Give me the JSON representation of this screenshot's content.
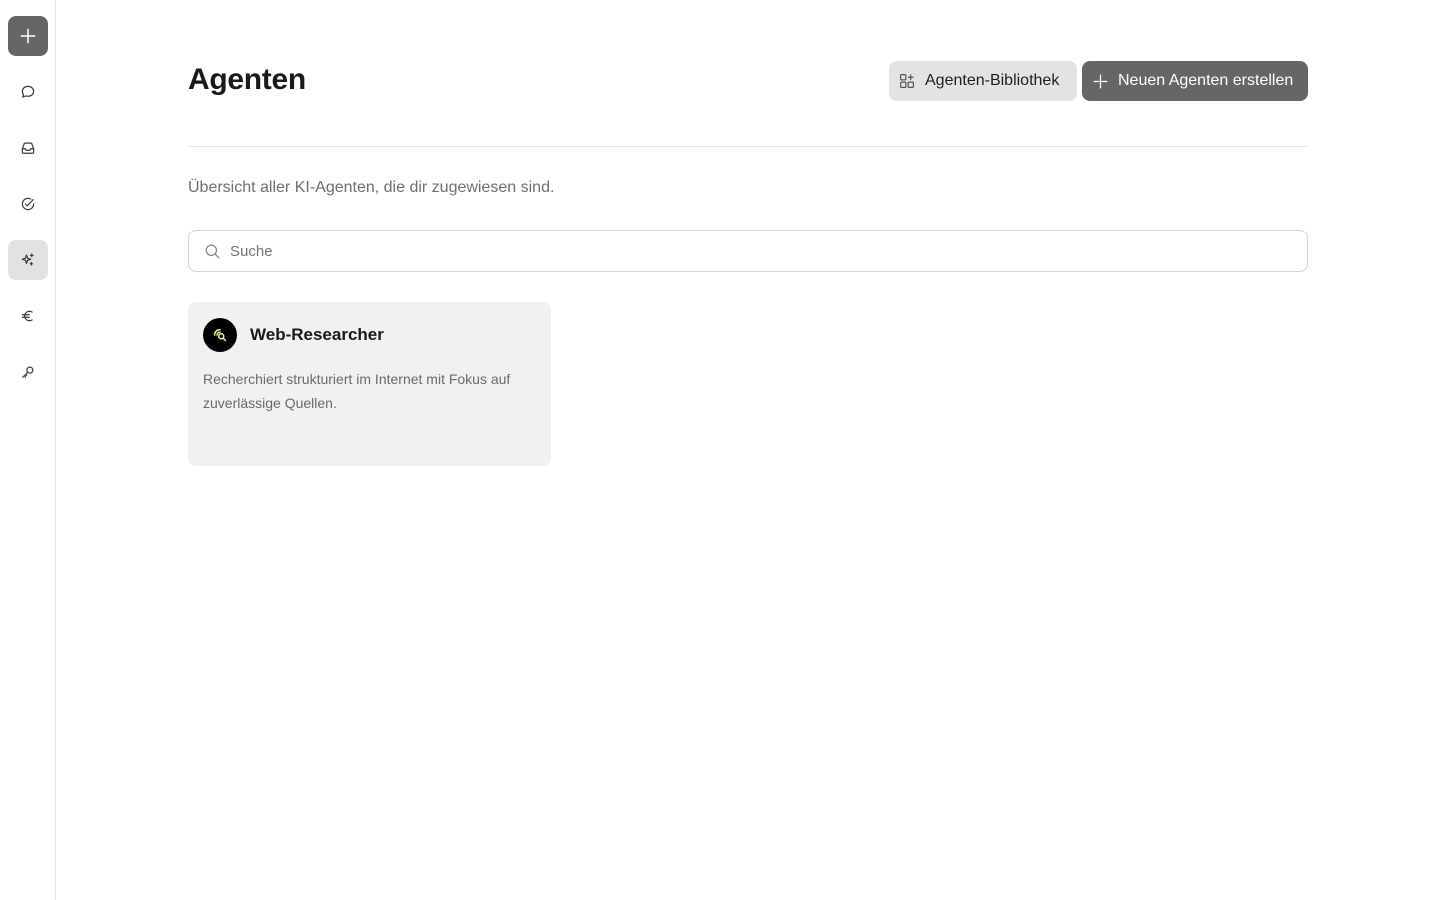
{
  "sidebar": {
    "items": [
      {
        "name": "new",
        "icon": "plus-icon"
      },
      {
        "name": "chat",
        "icon": "chat-bubble-icon"
      },
      {
        "name": "inbox",
        "icon": "inbox-icon"
      },
      {
        "name": "tasks",
        "icon": "check-circle-icon"
      },
      {
        "name": "agents",
        "icon": "sparkles-icon",
        "active": true
      },
      {
        "name": "billing",
        "icon": "euro-icon"
      },
      {
        "name": "keys",
        "icon": "key-icon"
      }
    ]
  },
  "header": {
    "title": "Agenten",
    "library_label": "Agenten-Bibliothek",
    "create_label": "Neuen Agenten erstellen"
  },
  "subtitle": "Übersicht aller KI-Agenten, die dir zugewiesen sind.",
  "search": {
    "placeholder": "Suche",
    "value": ""
  },
  "agents": [
    {
      "name": "Web-Researcher",
      "description": "Recherchiert strukturiert im Internet mit Fokus auf zuverlässige Quellen.",
      "icon": "web-search-icon"
    }
  ],
  "colors": {
    "primary_button": "#666666",
    "secondary_button": "#e3e3e3",
    "card_background": "#f1f1f1",
    "active_nav": "#e2e2e2",
    "avatar_accent": "#f2f0a0"
  }
}
